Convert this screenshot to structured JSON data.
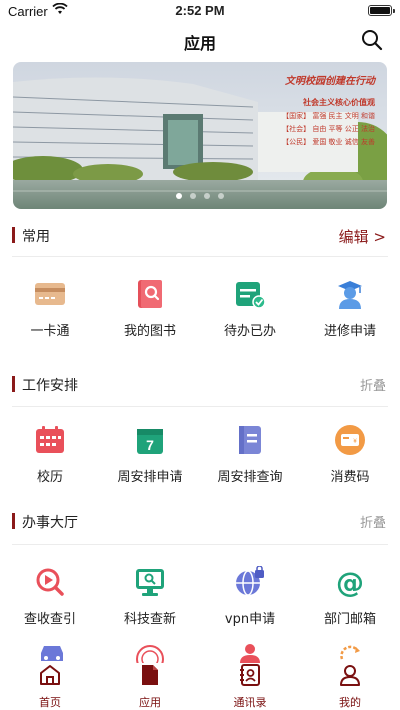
{
  "status_bar": {
    "carrier": "Carrier",
    "time": "2:52 PM"
  },
  "nav": {
    "title": "应用"
  },
  "banner": {
    "slogan_title": "文明校园创建在行动",
    "slogan_subtitle": "社会主义核心价值观",
    "slogan_lines": [
      "【国家】 富强 民主 文明 和谐",
      "【社会】 自由 平等 公正 法治",
      "【公民】 爱国 敬业 诚信 友善"
    ],
    "pages": 4,
    "active_page": 1
  },
  "sections": {
    "common": {
      "title": "常用",
      "action": "编辑 >",
      "items": [
        "一卡通",
        "我的图书",
        "待办已办",
        "进修申请"
      ]
    },
    "work": {
      "title": "工作安排",
      "action": "折叠",
      "items": [
        "校历",
        "周安排申请",
        "周安排查询",
        "消费码"
      ]
    },
    "affairs": {
      "title": "办事大厅",
      "action": "折叠",
      "items": [
        "查收查引",
        "科技查新",
        "vpn申请",
        "部门邮箱"
      ]
    }
  },
  "tab_bar": {
    "items": [
      "首页",
      "应用",
      "通讯录",
      "我的"
    ],
    "active": "应用"
  },
  "colors": {
    "accent": "#8b1a1a",
    "text": "#222222",
    "muted": "#999999"
  }
}
